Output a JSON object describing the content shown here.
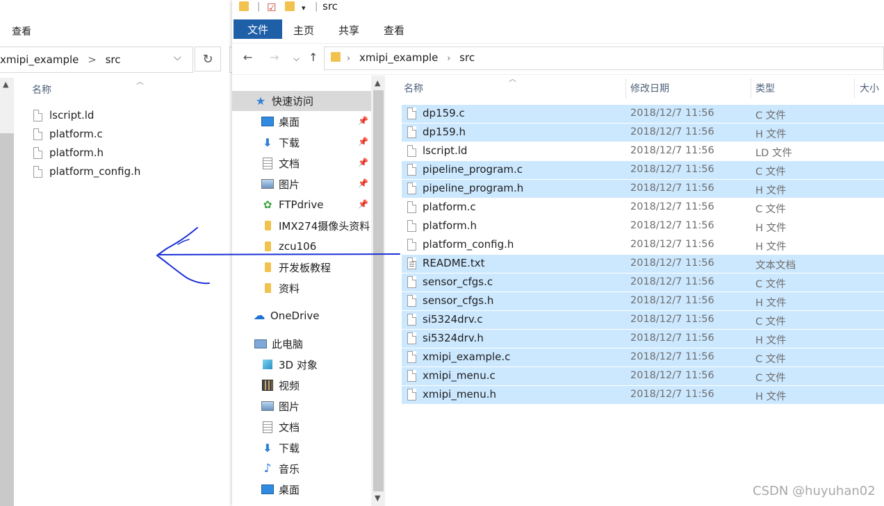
{
  "left_window": {
    "ribbon_tab": "查看",
    "address": "xmipi_example",
    "address_sep": ">",
    "address_folder": "src",
    "column_name": "名称",
    "files": [
      {
        "name": "lscript.ld",
        "icon": "file-icon"
      },
      {
        "name": "platform.c",
        "icon": "file-icon"
      },
      {
        "name": "platform.h",
        "icon": "file-icon"
      },
      {
        "name": "platform_config.h",
        "icon": "file-icon"
      }
    ]
  },
  "right_window": {
    "title": "src",
    "ribbon": {
      "tabs": [
        "文件",
        "主页",
        "共享",
        "查看"
      ],
      "active_color": "#1f5fa8"
    },
    "breadcrumb": [
      "xmipi_example",
      "src"
    ],
    "nav": {
      "quick_access": "快速访问",
      "quick_items": [
        "桌面",
        "下载",
        "文档",
        "图片",
        "FTPdrive"
      ],
      "folders": [
        "IMX274摄像头资料",
        "zcu106",
        "开发板教程",
        "资料"
      ],
      "onedrive": "OneDrive",
      "this_pc": "此电脑",
      "pc_items": [
        "3D 对象",
        "视频",
        "图片",
        "文档",
        "下载",
        "音乐",
        "桌面"
      ]
    },
    "columns": {
      "name": "名称",
      "date": "修改日期",
      "type": "类型",
      "size": "大小"
    },
    "selection_color": "#cce8ff",
    "files": [
      {
        "name": "dp159.c",
        "date": "2018/12/7 11:56",
        "type": "C 文件",
        "selected": true
      },
      {
        "name": "dp159.h",
        "date": "2018/12/7 11:56",
        "type": "H 文件",
        "selected": true
      },
      {
        "name": "lscript.ld",
        "date": "2018/12/7 11:56",
        "type": "LD 文件",
        "selected": false
      },
      {
        "name": "pipeline_program.c",
        "date": "2018/12/7 11:56",
        "type": "C 文件",
        "selected": true
      },
      {
        "name": "pipeline_program.h",
        "date": "2018/12/7 11:56",
        "type": "H 文件",
        "selected": true
      },
      {
        "name": "platform.c",
        "date": "2018/12/7 11:56",
        "type": "C 文件",
        "selected": false
      },
      {
        "name": "platform.h",
        "date": "2018/12/7 11:56",
        "type": "H 文件",
        "selected": false
      },
      {
        "name": "platform_config.h",
        "date": "2018/12/7 11:56",
        "type": "H 文件",
        "selected": false
      },
      {
        "name": "README.txt",
        "date": "2018/12/7 11:56",
        "type": "文本文档",
        "selected": true
      },
      {
        "name": "sensor_cfgs.c",
        "date": "2018/12/7 11:56",
        "type": "C 文件",
        "selected": true
      },
      {
        "name": "sensor_cfgs.h",
        "date": "2018/12/7 11:56",
        "type": "H 文件",
        "selected": true
      },
      {
        "name": "si5324drv.c",
        "date": "2018/12/7 11:56",
        "type": "C 文件",
        "selected": true
      },
      {
        "name": "si5324drv.h",
        "date": "2018/12/7 11:56",
        "type": "H 文件",
        "selected": true
      },
      {
        "name": "xmipi_example.c",
        "date": "2018/12/7 11:56",
        "type": "C 文件",
        "selected": true
      },
      {
        "name": "xmipi_menu.c",
        "date": "2018/12/7 11:56",
        "type": "C 文件",
        "selected": true
      },
      {
        "name": "xmipi_menu.h",
        "date": "2018/12/7 11:56",
        "type": "H 文件",
        "selected": true
      }
    ]
  },
  "annotation": {
    "color": "#1a2fd6"
  },
  "watermark": "CSDN @huyuhan02"
}
